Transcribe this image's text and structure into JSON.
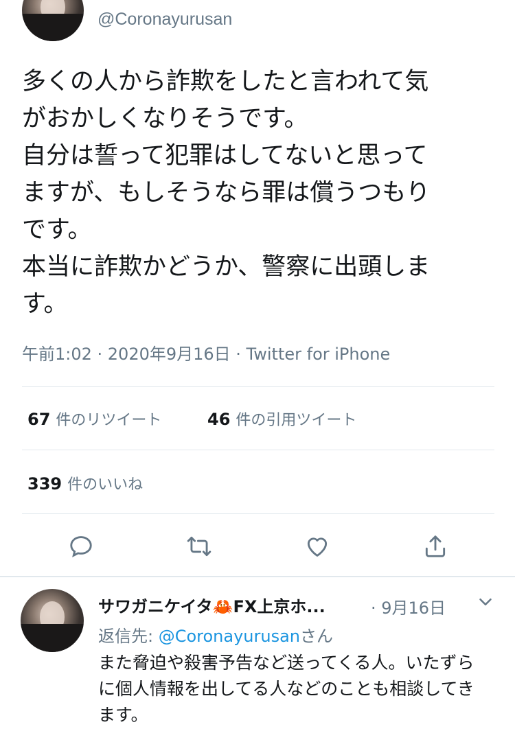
{
  "tweet": {
    "handle": "@Coronayurusan",
    "text": "多くの人から詐欺をしたと言われて気\nがおかしくなりそうです。\n自分は誓って犯罪はしてないと思って\nますが、もしそうなら罪は償うつもり\nです。\n本当に詐欺かどうか、警察に出頭しま\nす。",
    "meta": "午前1:02 · 2020年9月16日 · Twitter for iPhone"
  },
  "stats": {
    "retweets": {
      "count": "67",
      "label": "件のリツイート"
    },
    "quotes": {
      "count": "46",
      "label": "件の引用ツイート"
    },
    "likes": {
      "count": "339",
      "label": "件のいいね"
    }
  },
  "actions": {
    "icons": [
      "reply-icon",
      "retweet-icon",
      "like-icon",
      "share-icon"
    ],
    "icon_color": "#657786"
  },
  "reply": {
    "name": "サワガニケイタ🦀FX上京ホ...",
    "date": "· 9月16日",
    "reply_prefix": "返信先: ",
    "reply_mention": "@Coronayurusan",
    "reply_suffix": "さん",
    "text": "また脅迫や殺害予告など送ってくる人。いたずら\nに個人情報を出してる人などのことも相談してき\nます。"
  },
  "colors": {
    "text": "#14171a",
    "secondary": "#657786",
    "link": "#1b95e0",
    "divider": "#e1e8ed"
  }
}
